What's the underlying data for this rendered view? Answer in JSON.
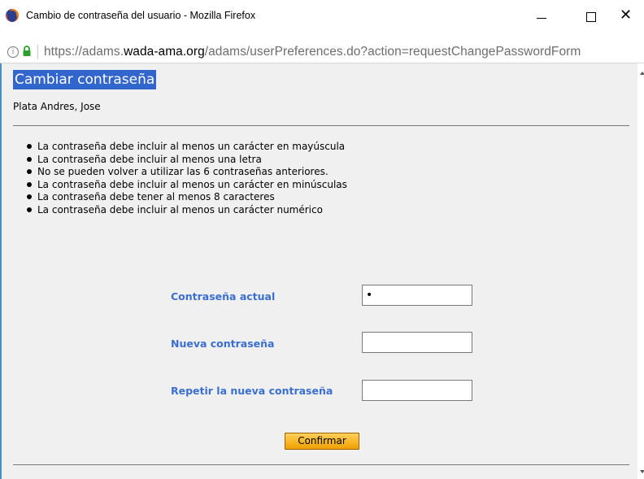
{
  "window": {
    "title": "Cambio de contraseña del usuario - Mozilla Firefox",
    "close_glyph": "✕"
  },
  "urlbar": {
    "url_prefix": "https://adams.",
    "url_domain": "wada-ama.org",
    "url_suffix": "/adams/userPreferences.do?action=requestChangePasswordForm",
    "info_glyph": "i"
  },
  "page": {
    "heading": "Cambiar contraseña",
    "user_name": "Plata Andres, Jose",
    "rules": [
      "La contraseña debe incluir al menos un carácter en mayúscula",
      "La contraseña debe incluir al menos una letra",
      "No se pueden volver a utilizar las 6 contraseñas anteriores.",
      "La contraseña debe incluir al menos un carácter en minúsculas",
      "La contraseña debe tener al menos 8 caracteres",
      "La contraseña debe incluir al menos un carácter numérico"
    ],
    "form": {
      "current_label": "Contraseña actual",
      "current_value": "•",
      "new_label": "Nueva contraseña",
      "new_value": "",
      "repeat_label": "Repetir la nueva contraseña",
      "repeat_value": "",
      "confirm_label": "Confirmar"
    }
  },
  "colors": {
    "heading_bg": "#3366cc",
    "label_color": "#3a6fd0",
    "button_bg": "#f5b21e",
    "page_bg": "#f0f0f0"
  },
  "icons": [
    "firefox-icon",
    "minimize-icon",
    "maximize-icon",
    "close-icon",
    "info-icon",
    "lock-icon",
    "scroll-up-icon",
    "scroll-down-icon"
  ]
}
